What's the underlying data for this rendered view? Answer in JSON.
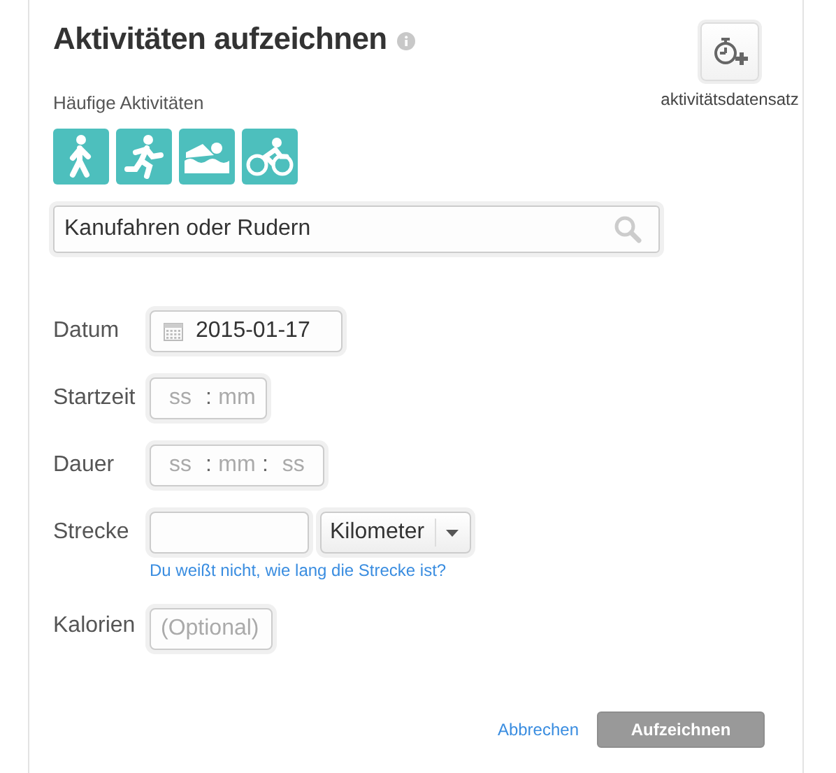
{
  "title": "Aktivitäten aufzeichnen",
  "record_button": {
    "label": "aktivitätsdatensatz"
  },
  "frequent": {
    "label": "Häufige Aktivitäten",
    "activities": [
      {
        "kind": "walk"
      },
      {
        "kind": "run"
      },
      {
        "kind": "swim"
      },
      {
        "kind": "bike"
      }
    ]
  },
  "search": {
    "value": "Kanufahren oder Rudern"
  },
  "fields": [
    {
      "kind": "date",
      "label": "Datum",
      "value": "2015-01-17"
    },
    {
      "kind": "time",
      "label": "Startzeit",
      "segments": [
        {
          "placeholder": "ss",
          "separator": ":"
        },
        {
          "placeholder": "mm"
        }
      ]
    },
    {
      "kind": "time",
      "label": "Dauer",
      "segments": [
        {
          "placeholder": "ss",
          "separator": ":"
        },
        {
          "placeholder": "mm",
          "separator": ":"
        },
        {
          "placeholder": "ss"
        }
      ]
    },
    {
      "kind": "distance",
      "label": "Strecke",
      "unit": "Kilometer",
      "help_link": "Du weißt nicht, wie lang die Strecke ist?"
    },
    {
      "kind": "text",
      "label": "Kalorien",
      "placeholder": "(Optional)"
    }
  ],
  "actions": {
    "cancel": "Abbrechen",
    "submit": {
      "label": "Aufzeichnen",
      "disabled": true
    }
  }
}
